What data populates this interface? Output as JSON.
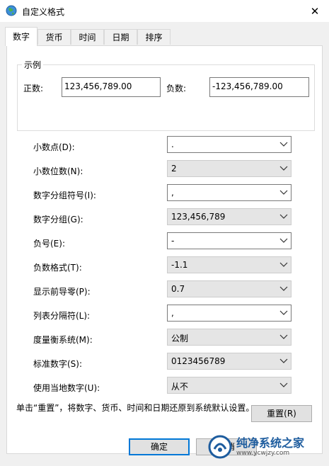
{
  "window": {
    "title": "自定义格式",
    "close_glyph": "✕"
  },
  "tabs": [
    {
      "label": "数字",
      "active": true
    },
    {
      "label": "货币",
      "active": false
    },
    {
      "label": "时间",
      "active": false
    },
    {
      "label": "日期",
      "active": false
    },
    {
      "label": "排序",
      "active": false
    }
  ],
  "samples": {
    "group_title": "示例",
    "positive_label": "正数:",
    "positive_value": "123,456,789.00",
    "negative_label": "负数:",
    "negative_value": "-123,456,789.00"
  },
  "settings": [
    {
      "label": "小数点(D):",
      "value": ".",
      "kind": "editable"
    },
    {
      "label": "小数位数(N):",
      "value": "2",
      "kind": "readonly"
    },
    {
      "label": "数字分组符号(I):",
      "value": ",",
      "kind": "editable"
    },
    {
      "label": "数字分组(G):",
      "value": "123,456,789",
      "kind": "readonly"
    },
    {
      "label": "负号(E):",
      "value": "-",
      "kind": "editable"
    },
    {
      "label": "负数格式(T):",
      "value": "-1.1",
      "kind": "readonly"
    },
    {
      "label": "显示前导零(P):",
      "value": "0.7",
      "kind": "readonly"
    },
    {
      "label": "列表分隔符(L):",
      "value": ",",
      "kind": "editable"
    },
    {
      "label": "度量衡系统(M):",
      "value": "公制",
      "kind": "readonly"
    },
    {
      "label": "标准数字(S):",
      "value": "0123456789",
      "kind": "readonly"
    },
    {
      "label": "使用当地数字(U):",
      "value": "从不",
      "kind": "readonly"
    }
  ],
  "note": "单击“重置”，将数字、货币、时间和日期还原到系统默认设置。",
  "buttons": {
    "reset": "重置(R)",
    "ok": "确定",
    "cancel": "取消"
  },
  "watermark": {
    "text": "纯净系统之家",
    "url": "www.ycwjzy.com"
  },
  "colors": {
    "accent": "#0078d7",
    "watermark": "#1d5c9e"
  }
}
